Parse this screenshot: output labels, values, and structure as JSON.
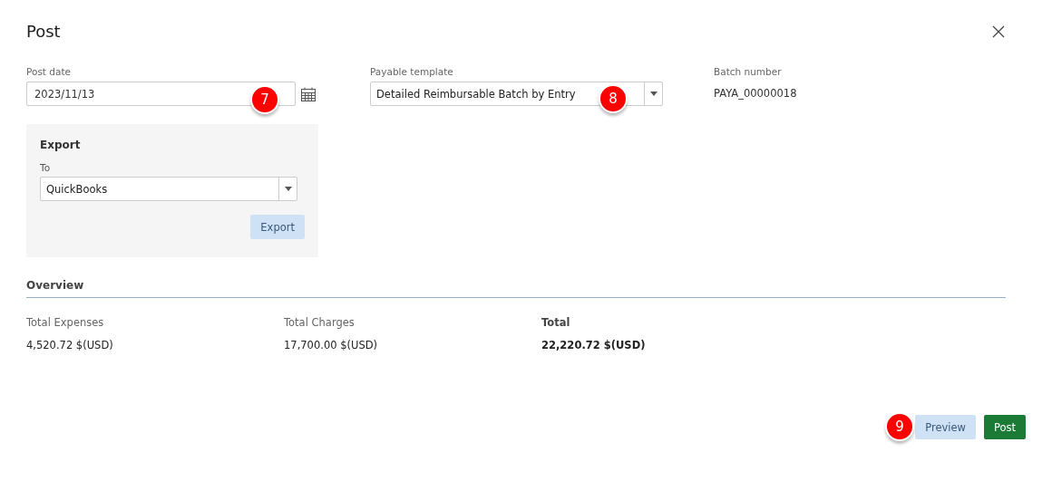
{
  "dialog": {
    "title": "Post"
  },
  "fields": [
    {
      "kind": "date",
      "label": "Post date",
      "value": "2023/11/13"
    },
    {
      "kind": "select",
      "label": "Payable template",
      "value": "Detailed Reimbursable Batch by Entry"
    },
    {
      "kind": "text",
      "label": "Batch number",
      "value": "PAYA_00000018"
    }
  ],
  "export": {
    "title": "Export",
    "to_label": "To",
    "to_value": "QuickBooks",
    "button": "Export"
  },
  "overview": {
    "title": "Overview",
    "totals": [
      {
        "label": "Total Expenses",
        "value": "4,520.72 $(USD)",
        "emphasis": false
      },
      {
        "label": "Total Charges",
        "value": "17,700.00 $(USD)",
        "emphasis": false
      },
      {
        "label": "Total",
        "value": "22,220.72 $(USD)",
        "emphasis": true
      }
    ]
  },
  "buttons": [
    {
      "label": "Preview",
      "kind": "secondary"
    },
    {
      "label": "Post",
      "kind": "primary"
    }
  ],
  "callouts": [
    {
      "label": "7"
    },
    {
      "label": "8"
    },
    {
      "label": "9"
    }
  ]
}
